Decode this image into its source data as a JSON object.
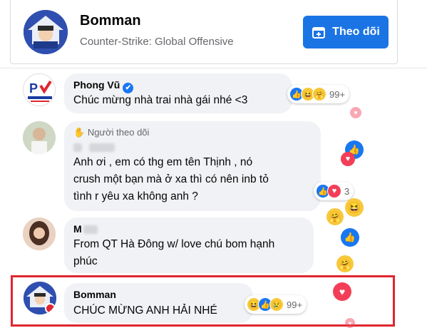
{
  "header": {
    "name": "Bomman",
    "subtitle": "Counter-Strike: Global Offensive",
    "follow_label": "Theo dõi"
  },
  "comments": [
    {
      "name": "Phong Vũ",
      "verified": true,
      "text": "Chúc mừng nhà trai nhà gái nhé <3",
      "reaction_count": "99+"
    },
    {
      "badge": "Người theo dõi",
      "text_lines": [
        "Anh ơi , em có thg em tên Thịnh , nó",
        "crush một bạn mà ở xa thì có nên inb tỏ",
        "tình r yêu xa không anh ?"
      ],
      "reaction_count": "3"
    },
    {
      "text_lines": [
        "From QT Hà Đông w/ love chú bom hạnh",
        "phúc"
      ]
    },
    {
      "name": "Bomman",
      "text": "CHÚC MỪNG ANH HẢI NHÉ",
      "reaction_count": "99+"
    }
  ],
  "colors": {
    "follow_button": "#1b74e4",
    "bubble": "#f0f2f5",
    "highlight": "#e0262f",
    "like": "#1877f2",
    "love": "#f33e58"
  }
}
